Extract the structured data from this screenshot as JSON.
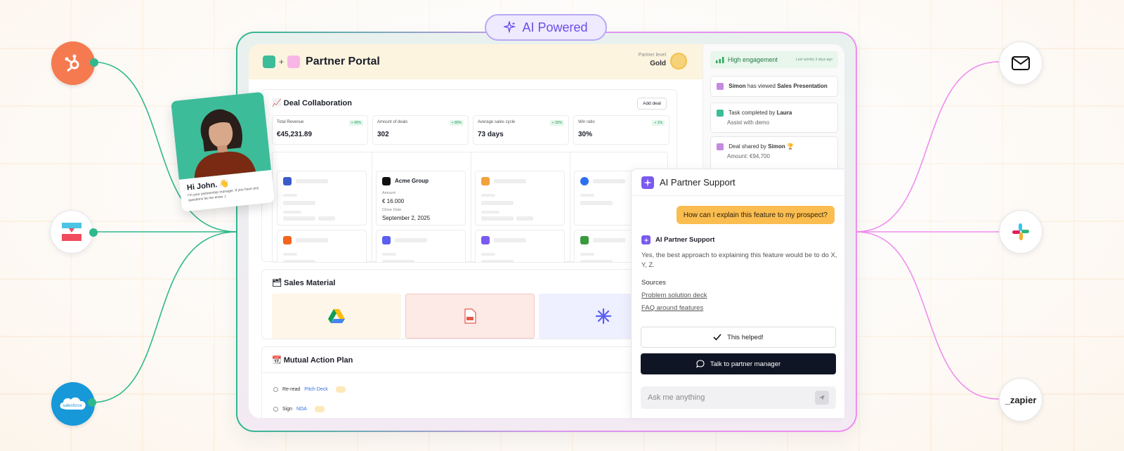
{
  "badge": {
    "label": "AI Powered"
  },
  "portal": {
    "title": "Partner Portal",
    "plus": "+",
    "partner_level_label": "Partner level",
    "partner_level_value": "Gold"
  },
  "deal_collaboration": {
    "title": "Deal Collaboration",
    "add_deal_label": "Add deal",
    "metrics": [
      {
        "label": "Total Revenue",
        "delta": "+ 45%",
        "value": "€45,231.89"
      },
      {
        "label": "Amount of deals",
        "delta": "+ 80%",
        "value": "302"
      },
      {
        "label": "Average sales cycle",
        "delta": "+ 32%",
        "value": "73 days"
      },
      {
        "label": "Win ratio",
        "delta": "+ 1%",
        "value": "30%"
      }
    ],
    "acme": {
      "name": "Acme Group",
      "amount_label": "Amount",
      "amount_value": "€ 16.000",
      "close_label": "Close Date",
      "close_value": "September 2, 2025"
    }
  },
  "sales_material": {
    "title": "Sales Material"
  },
  "mutual_action_plan": {
    "title": "Mutual Action Plan",
    "items": [
      {
        "prefix": "Re-read",
        "link": "Pitch Deck"
      },
      {
        "prefix": "Sign",
        "link": "NDA"
      }
    ]
  },
  "activity": {
    "engagement_label": "High engagement",
    "engagement_meta": "Last activity 3 days ago",
    "items": [
      {
        "name": "Simon",
        "text": "has viewed",
        "object": "Sales Presentation"
      },
      {
        "text": "Task completed by",
        "name": "Laura",
        "sub": "Assist with demo"
      },
      {
        "text": "Deal shared by",
        "name": "Simon",
        "sub": "Amount: €94,700"
      }
    ]
  },
  "contact_card": {
    "greeting": "Hi John. 👋",
    "message": "I'm your partnership manager. If you have any questions let me know :)"
  },
  "support": {
    "title": "AI Partner Support",
    "user_message": "How can I explain this feature to my prospect?",
    "bot_name": "AI Partner Support",
    "bot_answer": "Yes, the best approach to explaining this feature would be to do X, Y, Z.",
    "sources_label": "Sources",
    "sources": [
      "Problem solution deck",
      "FAQ around features"
    ],
    "helped_label": "This helped!",
    "talk_label": "Talk to partner manager",
    "input_placeholder": "Ask me anything"
  },
  "integrations": {
    "left": [
      "hubspot-icon",
      "planhat-icon",
      "salesforce-icon"
    ],
    "right": [
      "email-icon",
      "slack-icon",
      "zapier-icon"
    ],
    "salesforce_text": "salesforce",
    "zapier_text": "_zapier"
  },
  "colors": {
    "green": "#2fb88d",
    "pink": "#f08df0",
    "purple": "#7a5af0",
    "hubspot": "#f57a50",
    "salesforce": "#1798d9",
    "amber": "#fbbd4f",
    "dark": "#101525"
  }
}
